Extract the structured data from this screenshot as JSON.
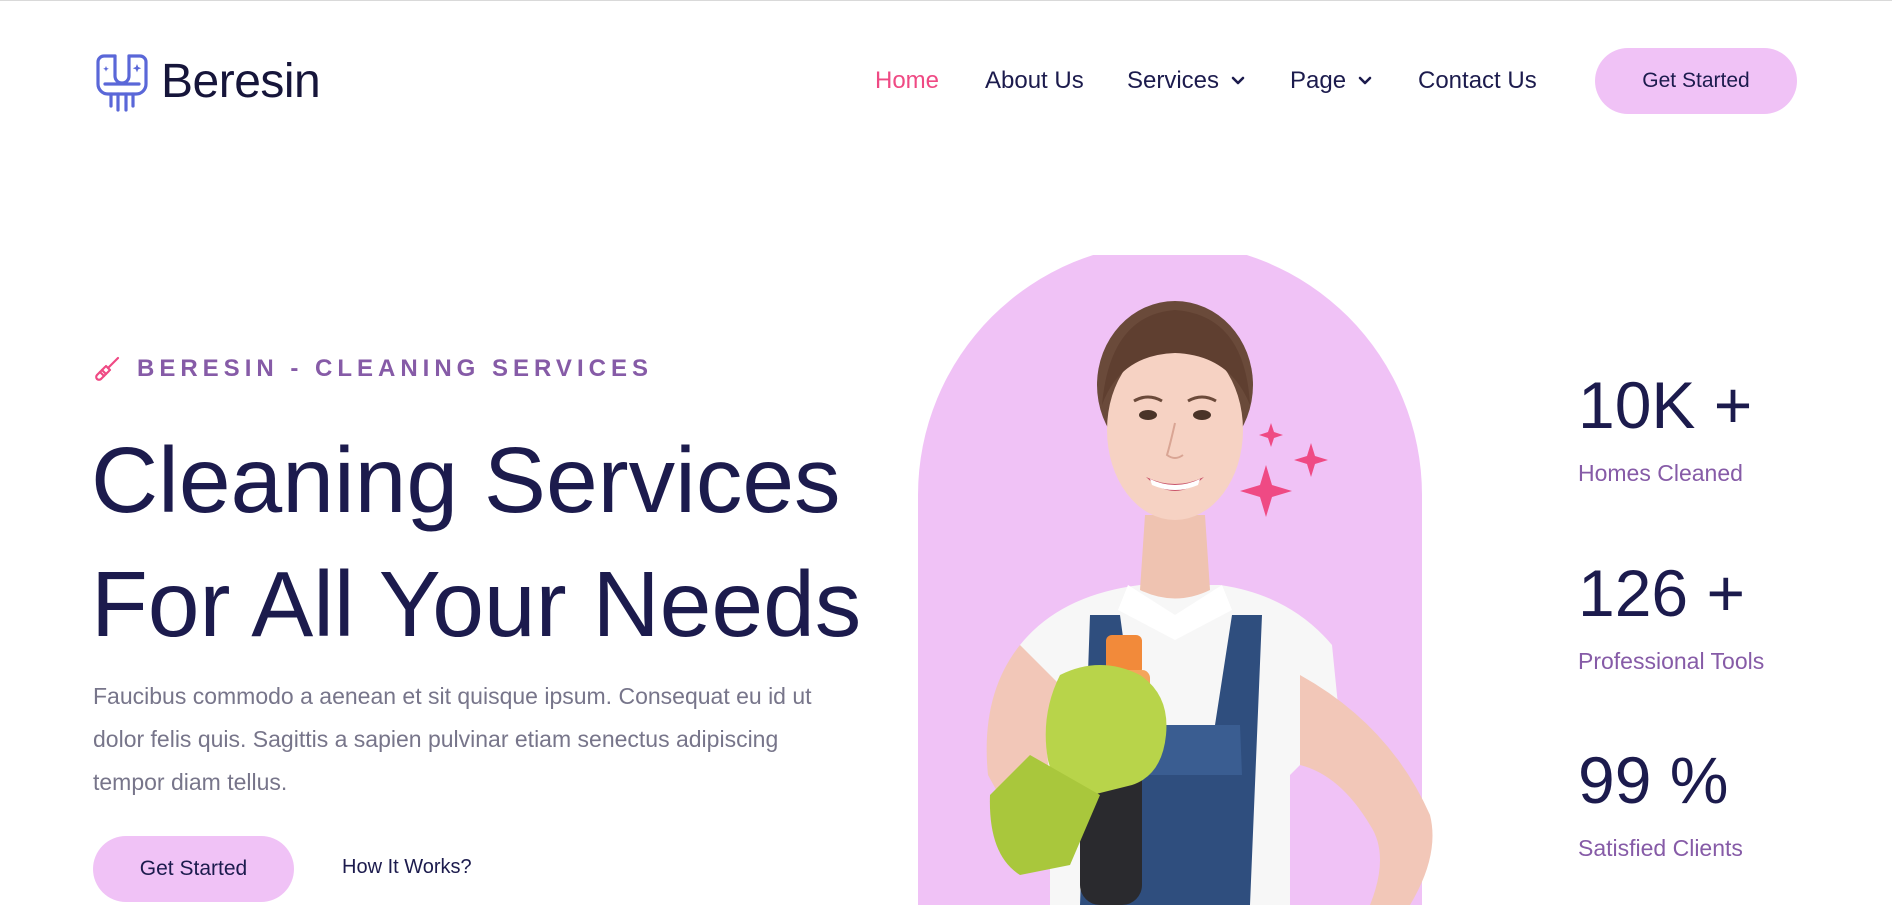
{
  "brand": {
    "name": "Beresin",
    "logo_icon": "brush-logo-icon"
  },
  "nav": {
    "items": [
      {
        "label": "Home",
        "active": true
      },
      {
        "label": "About Us"
      },
      {
        "label": "Services",
        "dropdown": true
      },
      {
        "label": "Page",
        "dropdown": true
      },
      {
        "label": "Contact Us"
      }
    ],
    "cta_label": "Get Started"
  },
  "hero": {
    "tagline_icon": "broom-icon",
    "tagline": "BERESIN - CLEANING SERVICES",
    "title_line1": "Cleaning Services",
    "title_line2": "For All Your Needs",
    "description": "Faucibus commodo a aenean et sit quisque ipsum. Consequat eu id ut dolor felis quis. Sagittis a sapien pulvinar etiam senectus adipiscing tempor diam tellus.",
    "primary_button": "Get Started",
    "secondary_link": "How It Works?"
  },
  "stats": [
    {
      "value": "10K +",
      "label": "Homes Cleaned"
    },
    {
      "value": "126 +",
      "label": "Professional Tools"
    },
    {
      "value": "99 %",
      "label": "Satisfied Clients"
    }
  ],
  "colors": {
    "accent_pink": "#ef4a84",
    "button_bg": "#f0c2f6",
    "navy": "#1c1b4d",
    "purple_text": "#865ba7",
    "body_gray": "#77758a"
  }
}
